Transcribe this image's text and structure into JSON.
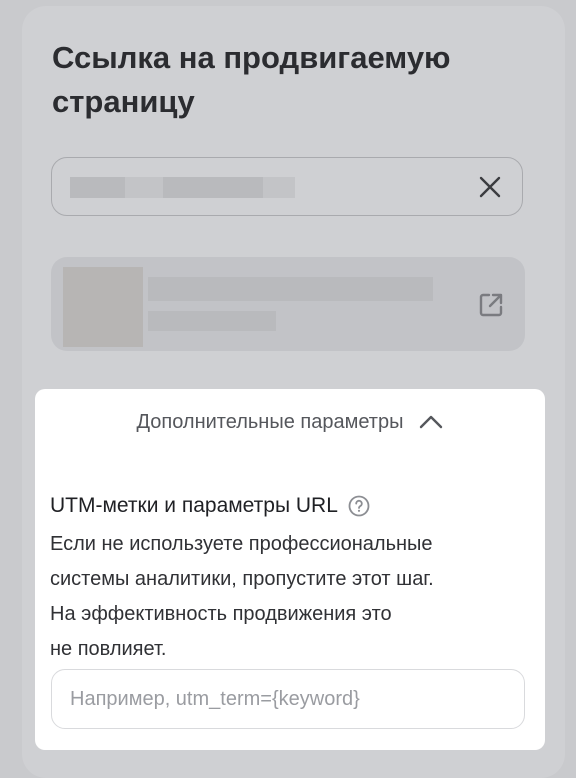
{
  "page": {
    "title": "Ссылка на продвигаемую страницу"
  },
  "url_field": {
    "clear_icon": "close-icon"
  },
  "link_preview": {
    "open_icon": "external-link-icon"
  },
  "advanced": {
    "toggle_label": "Дополнительные параметры",
    "toggle_icon": "chevron-up-icon",
    "utm_title": "UTM-метки и параметры URL",
    "help_icon": "question-icon",
    "description_lines": [
      "Если не используете профессиональные",
      "системы аналитики, пропустите этот шаг.",
      "На эффективность продвижения это",
      "не повлияет."
    ],
    "utm_placeholder": "Например, utm_term={keyword}"
  },
  "colors": {
    "background_dim": "#c9cacd",
    "sheet": "#ffffff",
    "text_primary": "#1f2024",
    "text_secondary": "#55575c"
  }
}
